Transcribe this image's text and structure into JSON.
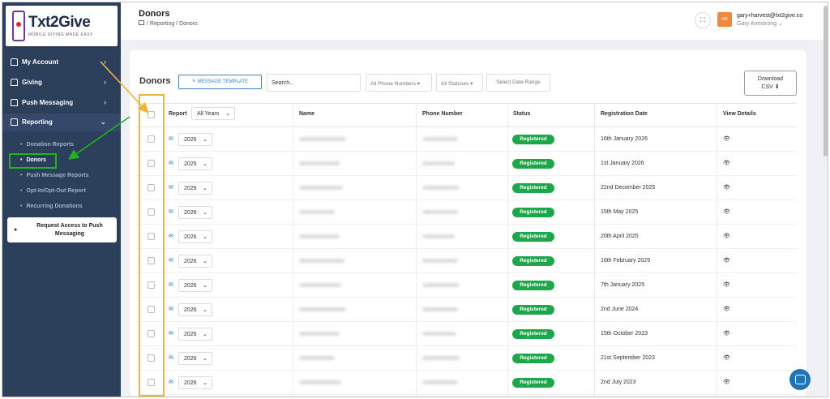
{
  "brand": {
    "name": "Txt2Give",
    "tagline": "MOBILE GIVING MADE EASY"
  },
  "sidebar": {
    "items": [
      {
        "label": "My Account",
        "chevron": "›"
      },
      {
        "label": "Giving",
        "chevron": "›"
      },
      {
        "label": "Push Messaging",
        "chevron": "›"
      },
      {
        "label": "Reporting",
        "chevron": "⌄"
      }
    ],
    "sub_items": [
      "Donation Reports",
      "Donors",
      "Push Message Reports",
      "Opt-In/Opt-Out Report",
      "Recurring Donations"
    ],
    "request_button": "Request Access to Push Messaging"
  },
  "header": {
    "title": "Donors",
    "breadcrumb": "/ Reporting / Donors",
    "user_initials": "GA",
    "user_email": "gary+harvest@txt2give.co",
    "user_name": "Gary Armstrong ⌄"
  },
  "toolbar": {
    "heading": "Donors",
    "message_template": "✎ MESSAGE TEMPLATE",
    "search_value": "Search...",
    "phone_filter": "All Phone Numbers ▾",
    "status_filter": "All Statuses ▾",
    "date_range": "Select Date Range",
    "download_line1": "Download",
    "download_line2": "CSV ⬇"
  },
  "table": {
    "columns": {
      "report": "Report",
      "report_filter": "All Years",
      "name": "Name",
      "phone": "Phone Number",
      "status": "Status",
      "registration_date": "Registration Date",
      "view_details": "View Details"
    },
    "rows": [
      {
        "year": "2026",
        "status": "Registered",
        "date": "16th January 2026"
      },
      {
        "year": "2025",
        "status": "Registered",
        "date": "1st January 2026"
      },
      {
        "year": "2026",
        "status": "Registered",
        "date": "22nd December 2025"
      },
      {
        "year": "2026",
        "status": "Registered",
        "date": "15th May 2025"
      },
      {
        "year": "2026",
        "status": "Registered",
        "date": "20th April 2025"
      },
      {
        "year": "2026",
        "status": "Registered",
        "date": "16th February 2025"
      },
      {
        "year": "2026",
        "status": "Registered",
        "date": "7th January 2025"
      },
      {
        "year": "2026",
        "status": "Registered",
        "date": "2nd June 2024"
      },
      {
        "year": "2026",
        "status": "Registered",
        "date": "15th October 2023"
      },
      {
        "year": "2026",
        "status": "Registered",
        "date": "21st September 2023"
      },
      {
        "year": "2026",
        "status": "Registered",
        "date": "2nd July 2023"
      }
    ]
  },
  "colors": {
    "sidebar_bg": "#2b3e5a",
    "status_green": "#1ea64a",
    "accent_blue": "#3a84c9",
    "highlight_orange": "#f0b43a",
    "highlight_green": "#22b322"
  },
  "icons": [
    "home-icon",
    "chevron-icon",
    "mail-icon",
    "eye-icon",
    "download-icon",
    "fullscreen-icon",
    "chat-icon"
  ]
}
